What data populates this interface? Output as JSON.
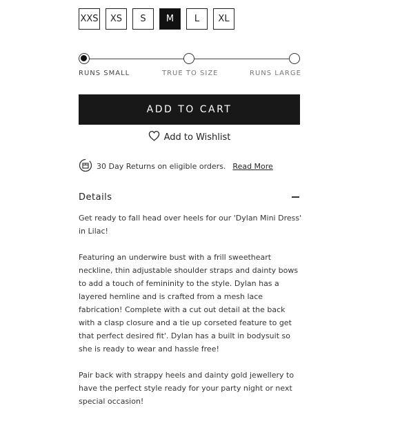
{
  "sizes": {
    "options": [
      "XXS",
      "XS",
      "S",
      "M",
      "L",
      "XL"
    ],
    "selected": "M"
  },
  "fit_scale": {
    "labels": [
      "RUNS SMALL",
      "TRUE TO SIZE",
      "RUNS LARGE"
    ],
    "selected": "RUNS SMALL"
  },
  "cart": {
    "label": "ADD TO CART"
  },
  "wishlist": {
    "label": "Add to Wishlist",
    "icon": "heart-icon"
  },
  "returns": {
    "icon": "return-box-icon",
    "text": "30 Day Returns on eligible orders.",
    "link_label": "Read More"
  },
  "details": {
    "title": "Details",
    "toggle_icon": "minus-icon",
    "paragraphs": [
      "Get ready to fall head over heels for our 'Dylan Mini Dress' in Lilac!",
      "Featuring an underwire bust with a frill sweetheart neckline, thin adjustable shoulder straps and dainty bows to add a touch of femininity to the style. Dylan has a layered hemline and is crafted from a mesh lace fabrication! Complete with a cut out detail at the back with a clasp closure and a tie up corseted feature to get that perfect desired fit'. Dylan has a built in bodysuit so she is ready to wear and hassle free!",
      "Pair back with strappy heels and dainty gold jewellery to have the perfect style ready for your party night or next special occasion!"
    ]
  },
  "colors": {
    "primary": "#181818",
    "text": "#222222",
    "muted": "#777777"
  }
}
